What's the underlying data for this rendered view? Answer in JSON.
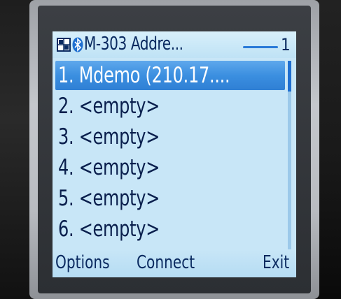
{
  "window": {
    "title": "M-303 Addre...",
    "list_index": "1"
  },
  "icons": {
    "app": "app-grid-icon",
    "bluetooth": "bluetooth-icon"
  },
  "list": {
    "items": [
      {
        "label": "1. Mdemo (210.17....",
        "selected": true
      },
      {
        "label": "2. <empty>",
        "selected": false
      },
      {
        "label": "3. <empty>",
        "selected": false
      },
      {
        "label": "4. <empty>",
        "selected": false
      },
      {
        "label": "5. <empty>",
        "selected": false
      },
      {
        "label": "6. <empty>",
        "selected": false
      }
    ]
  },
  "softkeys": {
    "left": "Options",
    "middle": "Connect",
    "right": "Exit"
  },
  "colors": {
    "screen_bg": "#c8e6f7",
    "selection": "#3b8fe0",
    "text": "#0a1f4d"
  }
}
